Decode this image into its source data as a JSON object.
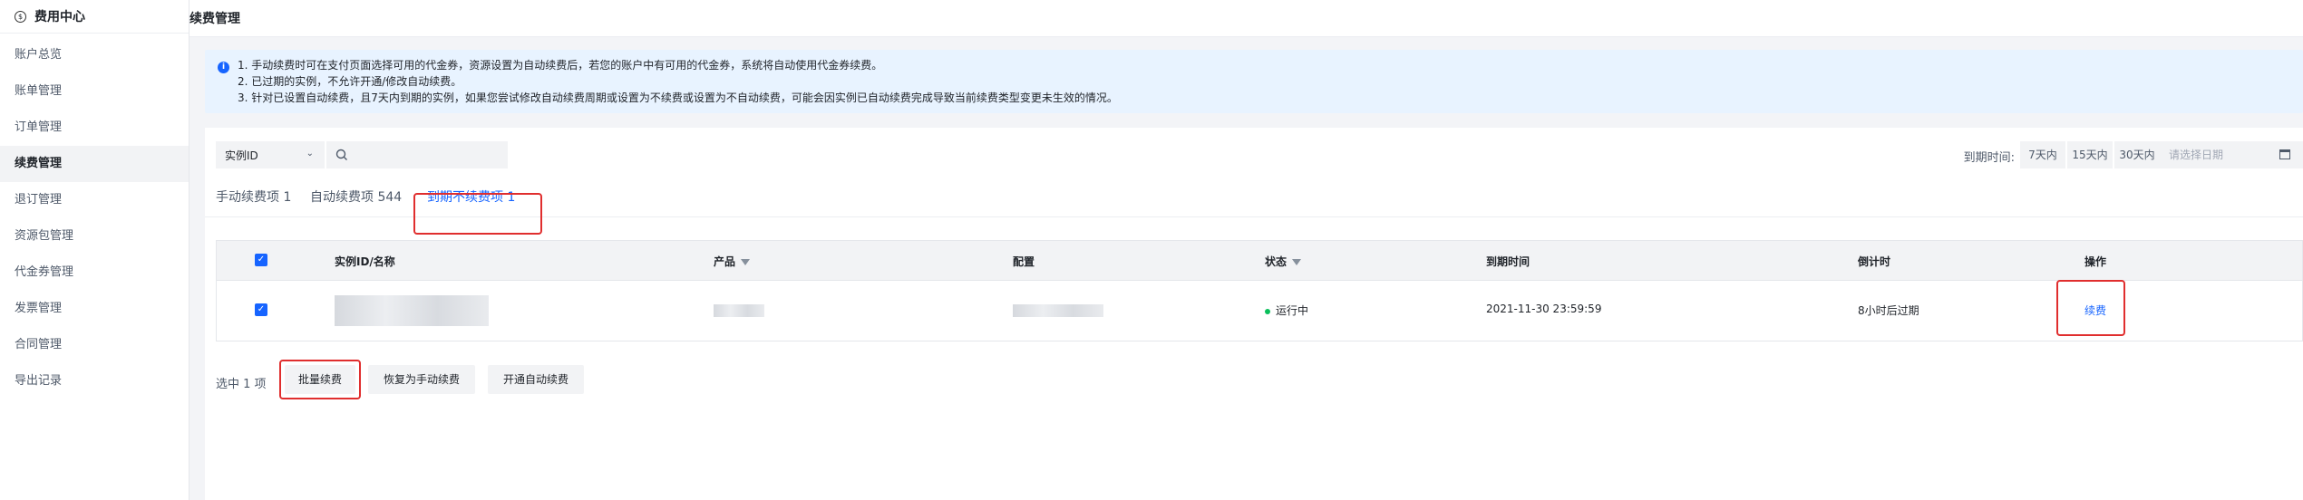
{
  "sidebar": {
    "title": "费用中心",
    "items": [
      "账户总览",
      "账单管理",
      "订单管理",
      "续费管理",
      "退订管理",
      "资源包管理",
      "代金券管理",
      "发票管理",
      "合同管理",
      "导出记录"
    ]
  },
  "header": {
    "title": "续费管理"
  },
  "notice": {
    "lines": [
      "1. 手动续费时可在支付页面选择可用的代金券，资源设置为自动续费后，若您的账户中有可用的代金券，系统将自动使用代金券续费。",
      "2. 已过期的实例，不允许开通/修改自动续费。",
      "3. 针对已设置自动续费，且7天内到期的实例，如果您尝试修改自动续费周期或设置为不续费或设置为不自动续费，可能会因实例已自动续费完成导致当前续费类型变更未生效的情况。"
    ]
  },
  "filters": {
    "select_value": "实例ID",
    "expiry_label": "到期时间:",
    "ranges": [
      "7天内",
      "15天内",
      "30天内"
    ],
    "date_placeholder": "请选择日期"
  },
  "tabs": [
    {
      "label": "手动续费项 1"
    },
    {
      "label": "自动续费项 544"
    },
    {
      "label": "到期不续费项 1"
    }
  ],
  "table": {
    "columns": [
      "实例ID/名称",
      "产品",
      "配置",
      "状态",
      "到期时间",
      "倒计时",
      "操作"
    ],
    "rows": [
      {
        "status": "运行中",
        "expire_time": "2021-11-30 23:59:59",
        "countdown": "8小时后过期",
        "action": "续费"
      }
    ]
  },
  "footer": {
    "selected_count": "选中 1 项",
    "buttons": [
      "批量续费",
      "恢复为手动续费",
      "开通自动续费"
    ]
  },
  "colors": {
    "accent": "#1664ff",
    "highlight": "#e02e2e",
    "running": "#0abf5b"
  }
}
